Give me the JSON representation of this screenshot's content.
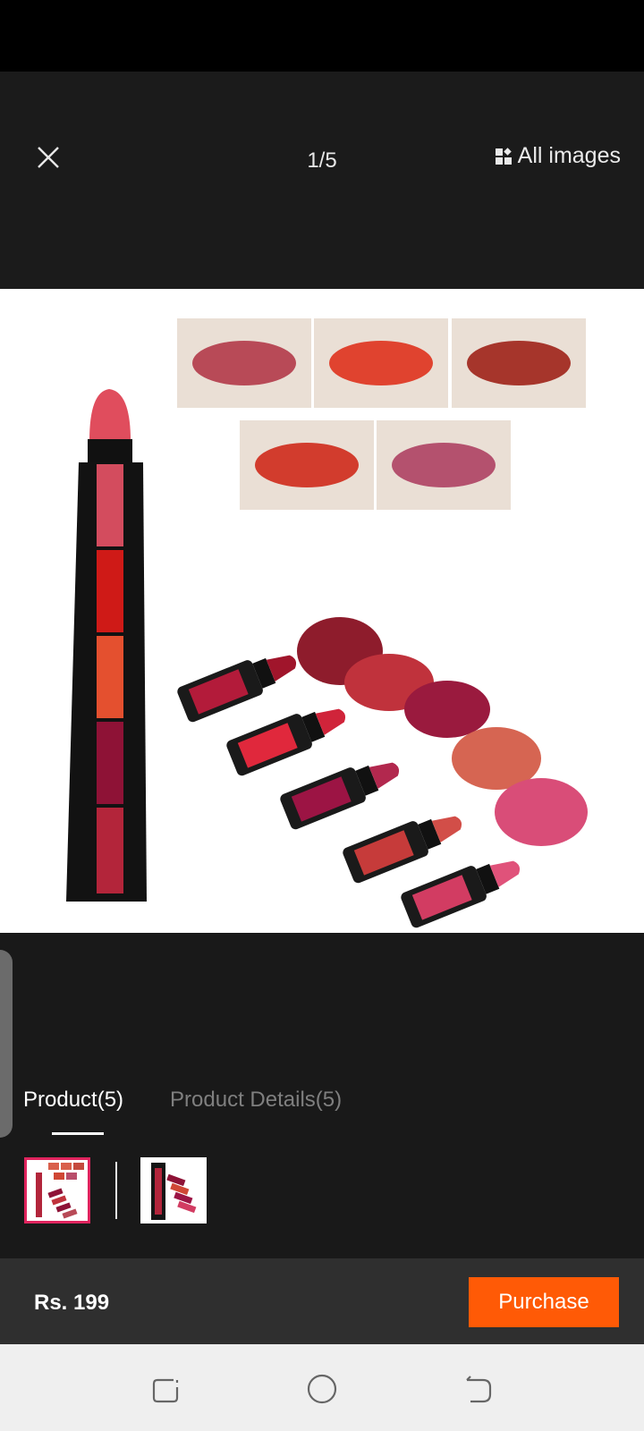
{
  "header": {
    "counter": "1/5",
    "all_images_label": "All images"
  },
  "tabs": [
    {
      "label": "Product(5)",
      "active": true
    },
    {
      "label": "Product Details(5)",
      "active": false
    }
  ],
  "product_image": {
    "description_colors": [
      "#d34c5e",
      "#cf1a17",
      "#e4502f",
      "#8e1236",
      "#b3253a"
    ]
  },
  "footer": {
    "price": "Rs. 199",
    "purchase_label": "Purchase"
  },
  "navigation": {
    "icons": [
      "recent-apps-icon",
      "home-icon",
      "back-icon"
    ]
  },
  "colors": {
    "accent": "#ff5a06",
    "selected_thumb_border": "#e0245e",
    "background": "#191919"
  }
}
